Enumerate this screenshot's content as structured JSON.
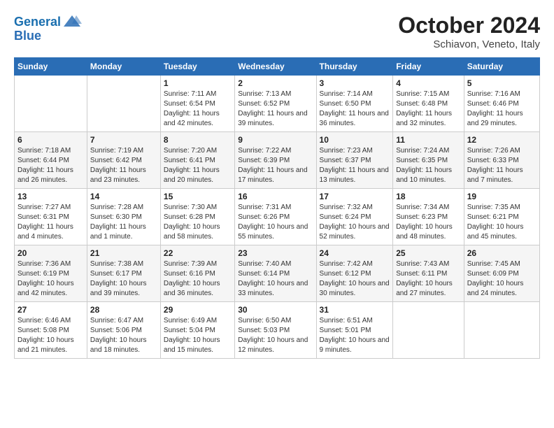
{
  "logo": {
    "line1": "General",
    "line2": "Blue"
  },
  "title": "October 2024",
  "subtitle": "Schiavon, Veneto, Italy",
  "days_of_week": [
    "Sunday",
    "Monday",
    "Tuesday",
    "Wednesday",
    "Thursday",
    "Friday",
    "Saturday"
  ],
  "weeks": [
    [
      {
        "day": "",
        "sunrise": "",
        "sunset": "",
        "daylight": ""
      },
      {
        "day": "",
        "sunrise": "",
        "sunset": "",
        "daylight": ""
      },
      {
        "day": "1",
        "sunrise": "Sunrise: 7:11 AM",
        "sunset": "Sunset: 6:54 PM",
        "daylight": "Daylight: 11 hours and 42 minutes."
      },
      {
        "day": "2",
        "sunrise": "Sunrise: 7:13 AM",
        "sunset": "Sunset: 6:52 PM",
        "daylight": "Daylight: 11 hours and 39 minutes."
      },
      {
        "day": "3",
        "sunrise": "Sunrise: 7:14 AM",
        "sunset": "Sunset: 6:50 PM",
        "daylight": "Daylight: 11 hours and 36 minutes."
      },
      {
        "day": "4",
        "sunrise": "Sunrise: 7:15 AM",
        "sunset": "Sunset: 6:48 PM",
        "daylight": "Daylight: 11 hours and 32 minutes."
      },
      {
        "day": "5",
        "sunrise": "Sunrise: 7:16 AM",
        "sunset": "Sunset: 6:46 PM",
        "daylight": "Daylight: 11 hours and 29 minutes."
      }
    ],
    [
      {
        "day": "6",
        "sunrise": "Sunrise: 7:18 AM",
        "sunset": "Sunset: 6:44 PM",
        "daylight": "Daylight: 11 hours and 26 minutes."
      },
      {
        "day": "7",
        "sunrise": "Sunrise: 7:19 AM",
        "sunset": "Sunset: 6:42 PM",
        "daylight": "Daylight: 11 hours and 23 minutes."
      },
      {
        "day": "8",
        "sunrise": "Sunrise: 7:20 AM",
        "sunset": "Sunset: 6:41 PM",
        "daylight": "Daylight: 11 hours and 20 minutes."
      },
      {
        "day": "9",
        "sunrise": "Sunrise: 7:22 AM",
        "sunset": "Sunset: 6:39 PM",
        "daylight": "Daylight: 11 hours and 17 minutes."
      },
      {
        "day": "10",
        "sunrise": "Sunrise: 7:23 AM",
        "sunset": "Sunset: 6:37 PM",
        "daylight": "Daylight: 11 hours and 13 minutes."
      },
      {
        "day": "11",
        "sunrise": "Sunrise: 7:24 AM",
        "sunset": "Sunset: 6:35 PM",
        "daylight": "Daylight: 11 hours and 10 minutes."
      },
      {
        "day": "12",
        "sunrise": "Sunrise: 7:26 AM",
        "sunset": "Sunset: 6:33 PM",
        "daylight": "Daylight: 11 hours and 7 minutes."
      }
    ],
    [
      {
        "day": "13",
        "sunrise": "Sunrise: 7:27 AM",
        "sunset": "Sunset: 6:31 PM",
        "daylight": "Daylight: 11 hours and 4 minutes."
      },
      {
        "day": "14",
        "sunrise": "Sunrise: 7:28 AM",
        "sunset": "Sunset: 6:30 PM",
        "daylight": "Daylight: 11 hours and 1 minute."
      },
      {
        "day": "15",
        "sunrise": "Sunrise: 7:30 AM",
        "sunset": "Sunset: 6:28 PM",
        "daylight": "Daylight: 10 hours and 58 minutes."
      },
      {
        "day": "16",
        "sunrise": "Sunrise: 7:31 AM",
        "sunset": "Sunset: 6:26 PM",
        "daylight": "Daylight: 10 hours and 55 minutes."
      },
      {
        "day": "17",
        "sunrise": "Sunrise: 7:32 AM",
        "sunset": "Sunset: 6:24 PM",
        "daylight": "Daylight: 10 hours and 52 minutes."
      },
      {
        "day": "18",
        "sunrise": "Sunrise: 7:34 AM",
        "sunset": "Sunset: 6:23 PM",
        "daylight": "Daylight: 10 hours and 48 minutes."
      },
      {
        "day": "19",
        "sunrise": "Sunrise: 7:35 AM",
        "sunset": "Sunset: 6:21 PM",
        "daylight": "Daylight: 10 hours and 45 minutes."
      }
    ],
    [
      {
        "day": "20",
        "sunrise": "Sunrise: 7:36 AM",
        "sunset": "Sunset: 6:19 PM",
        "daylight": "Daylight: 10 hours and 42 minutes."
      },
      {
        "day": "21",
        "sunrise": "Sunrise: 7:38 AM",
        "sunset": "Sunset: 6:17 PM",
        "daylight": "Daylight: 10 hours and 39 minutes."
      },
      {
        "day": "22",
        "sunrise": "Sunrise: 7:39 AM",
        "sunset": "Sunset: 6:16 PM",
        "daylight": "Daylight: 10 hours and 36 minutes."
      },
      {
        "day": "23",
        "sunrise": "Sunrise: 7:40 AM",
        "sunset": "Sunset: 6:14 PM",
        "daylight": "Daylight: 10 hours and 33 minutes."
      },
      {
        "day": "24",
        "sunrise": "Sunrise: 7:42 AM",
        "sunset": "Sunset: 6:12 PM",
        "daylight": "Daylight: 10 hours and 30 minutes."
      },
      {
        "day": "25",
        "sunrise": "Sunrise: 7:43 AM",
        "sunset": "Sunset: 6:11 PM",
        "daylight": "Daylight: 10 hours and 27 minutes."
      },
      {
        "day": "26",
        "sunrise": "Sunrise: 7:45 AM",
        "sunset": "Sunset: 6:09 PM",
        "daylight": "Daylight: 10 hours and 24 minutes."
      }
    ],
    [
      {
        "day": "27",
        "sunrise": "Sunrise: 6:46 AM",
        "sunset": "Sunset: 5:08 PM",
        "daylight": "Daylight: 10 hours and 21 minutes."
      },
      {
        "day": "28",
        "sunrise": "Sunrise: 6:47 AM",
        "sunset": "Sunset: 5:06 PM",
        "daylight": "Daylight: 10 hours and 18 minutes."
      },
      {
        "day": "29",
        "sunrise": "Sunrise: 6:49 AM",
        "sunset": "Sunset: 5:04 PM",
        "daylight": "Daylight: 10 hours and 15 minutes."
      },
      {
        "day": "30",
        "sunrise": "Sunrise: 6:50 AM",
        "sunset": "Sunset: 5:03 PM",
        "daylight": "Daylight: 10 hours and 12 minutes."
      },
      {
        "day": "31",
        "sunrise": "Sunrise: 6:51 AM",
        "sunset": "Sunset: 5:01 PM",
        "daylight": "Daylight: 10 hours and 9 minutes."
      },
      {
        "day": "",
        "sunrise": "",
        "sunset": "",
        "daylight": ""
      },
      {
        "day": "",
        "sunrise": "",
        "sunset": "",
        "daylight": ""
      }
    ]
  ]
}
